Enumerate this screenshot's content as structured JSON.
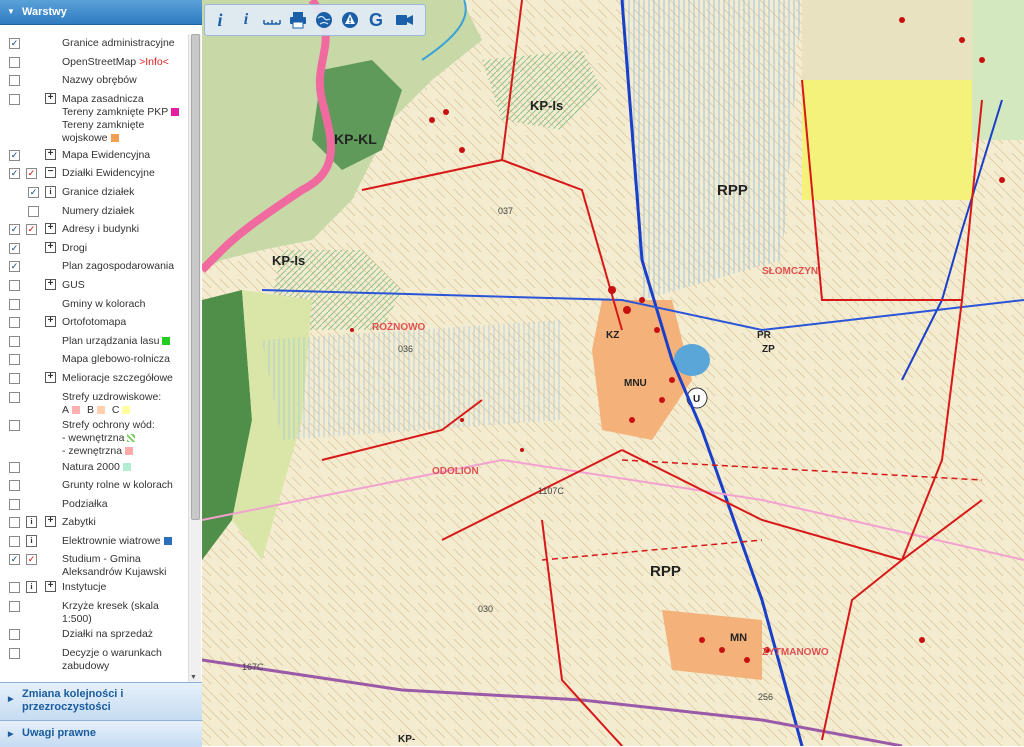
{
  "panel": {
    "header": "Warstwy",
    "layers": [
      {
        "label": "Granice administracyjne",
        "checked": true
      },
      {
        "label": "OpenStreetMap",
        "info": ">Info<",
        "checked": false
      },
      {
        "label": "Nazwy obrębów",
        "checked": false
      },
      {
        "label": "Mapa zasadnicza",
        "checked": false,
        "expand": "+",
        "extra": [
          "Tereny zamknięte PKP",
          "Tereny zamknięte wojskowe"
        ]
      },
      {
        "label": "Mapa Ewidencyjna",
        "checked": true,
        "expand": "+"
      },
      {
        "label": "Działki Ewidencyjne",
        "checked": true,
        "expand": "−"
      },
      {
        "label": "Granice działek",
        "checked": true
      },
      {
        "label": "Numery działek",
        "checked": false
      },
      {
        "label": "Adresy i budynki",
        "checked": true,
        "expand": "+"
      },
      {
        "label": "Drogi",
        "checked": true,
        "expand": "+"
      },
      {
        "label": "Plan zagospodarowania",
        "checked": true
      },
      {
        "label": "GUS",
        "checked": false,
        "expand": "+"
      },
      {
        "label": "Gminy w kolorach",
        "checked": false
      },
      {
        "label": "Ortofotomapa",
        "checked": false,
        "expand": "+"
      },
      {
        "label": "Plan urządzania lasu",
        "checked": false
      },
      {
        "label": "Mapa glebowo-rolnicza",
        "checked": false
      },
      {
        "label": "Melioracje szczegółowe",
        "checked": false,
        "expand": "+"
      },
      {
        "label": "Strefy uzdrowiskowe:",
        "checked": false,
        "extra": [
          "A",
          "B",
          "C"
        ]
      },
      {
        "label": "Strefy ochrony wód:",
        "checked": false,
        "extra": [
          "- wewnętrzna",
          "- zewnętrzna"
        ]
      },
      {
        "label": "Natura 2000",
        "checked": false
      },
      {
        "label": "Grunty rolne w kolorach",
        "checked": false
      },
      {
        "label": "Podziałka",
        "checked": false
      },
      {
        "label": "Zabytki",
        "checked": false,
        "expand": "+"
      },
      {
        "label": "Elektrownie wiatrowe",
        "checked": false
      },
      {
        "label": "Studium - Gmina",
        "label2": "Aleksandrów Kujawski",
        "checked": true
      },
      {
        "label": "Instytucje",
        "checked": false,
        "expand": "+"
      },
      {
        "label": "Krzyże kresek (skala",
        "label2": "1:500)",
        "checked": false
      },
      {
        "label": "Działki na sprzedaż",
        "checked": false
      },
      {
        "label": "Decyzje o warunkach",
        "label2": "zabudowy",
        "checked": false
      }
    ],
    "section_order": "Zmiana kolejności i przezroczystości",
    "section_legal": "Uwagi prawne"
  },
  "toolbar": {
    "icons": [
      "info-icon",
      "identify-icon",
      "measure-icon",
      "print-icon",
      "globe-icon",
      "warning-icon",
      "google-icon",
      "video-icon"
    ]
  },
  "map": {
    "labels": [
      "KP-KL",
      "KP-Is",
      "KP-Is",
      "RPP",
      "RPP",
      "MN",
      "MNU",
      "U",
      "PR",
      "KZ",
      "ZP",
      "KP-"
    ],
    "place_names": [
      "ROŻNOWO",
      "SŁOMCZYN",
      "ODOLION",
      "ZYTMANOWO"
    ],
    "road_labels": [
      "037",
      "036",
      "030",
      "256",
      "1107C",
      "167C"
    ]
  },
  "colors": {
    "accent": "#2f7bc1",
    "highlight_red": "#e02020",
    "swatch_pkp": "#e020a0",
    "swatch_military": "#f0a050",
    "swatch_forest": "#22cc22",
    "swatch_zone_a": "#ffb0b0",
    "swatch_zone_b": "#ffd0b0",
    "swatch_zone_c": "#ffffa0",
    "swatch_inner": "#7acb5a",
    "swatch_outer": "#ffaaaa",
    "swatch_natura": "#b0f0d0",
    "swatch_wind": "#2a6fb8"
  }
}
